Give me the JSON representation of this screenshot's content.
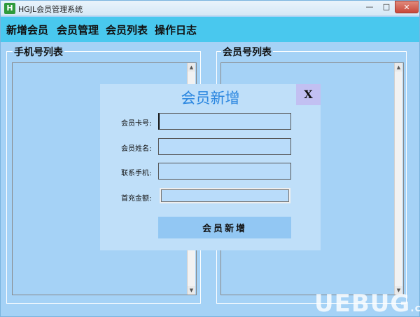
{
  "window": {
    "title": "HGJL会员管理系统",
    "controls": {
      "minimize": "—",
      "maximize": "□",
      "close": "✕"
    }
  },
  "menu": {
    "items": [
      "新增会员",
      "会员管理",
      "会员列表",
      "操作日志"
    ]
  },
  "panels": {
    "left": {
      "title": "手机号列表"
    },
    "right": {
      "title": "会员号列表"
    }
  },
  "dialog": {
    "title": "会员新增",
    "close_label": "X",
    "fields": [
      {
        "label": "会员卡号:",
        "value": ""
      },
      {
        "label": "会员姓名:",
        "value": ""
      },
      {
        "label": "联系手机:",
        "value": ""
      },
      {
        "label": "首充金额:",
        "value": ""
      }
    ],
    "submit_label": "会员新增"
  },
  "watermark": {
    "text": "UEBUG",
    "suffix": ".com"
  },
  "icons": {
    "app": "app-logo-icon",
    "scroll_up": "arrow-up-icon",
    "scroll_down": "arrow-down-icon"
  },
  "colors": {
    "window_bg": "#a5d2f6",
    "menubar": "#49c8ee",
    "dialog_bg": "#bfdff9",
    "dialog_title": "#2a86e0",
    "close_btn": "#c2c0f2",
    "submit_btn": "#92c7f3"
  }
}
